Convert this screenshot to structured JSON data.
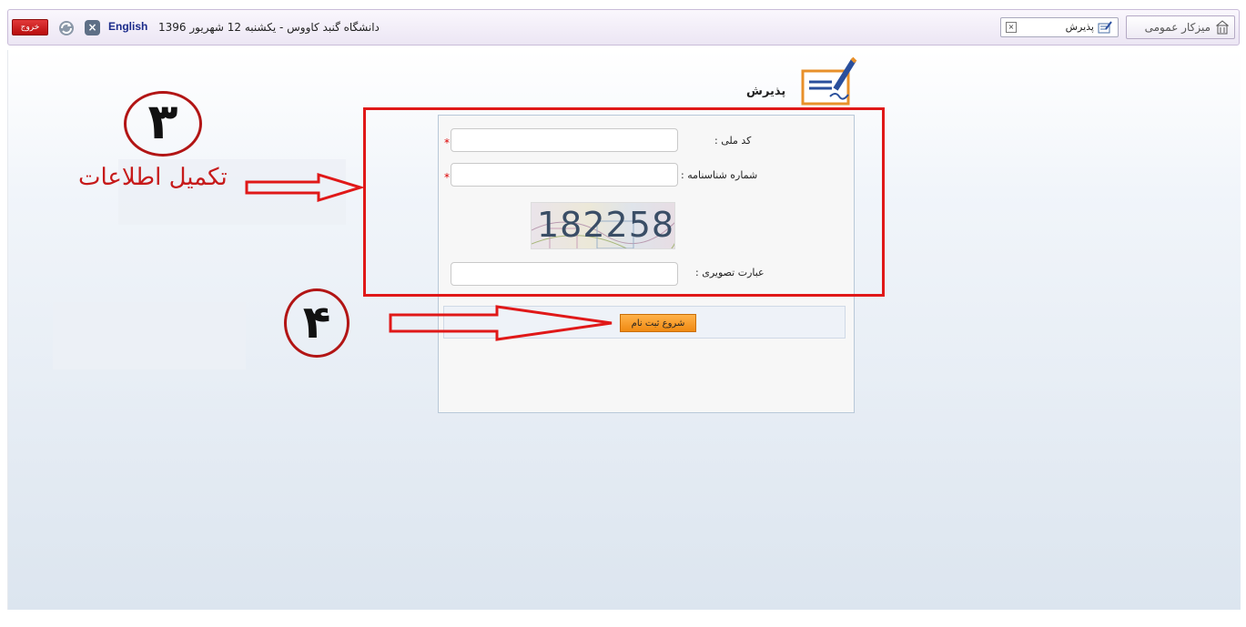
{
  "topbar": {
    "exit_label": "خروج",
    "language_link": "English",
    "status_text": "دانشگاه گنبد کاووس - یکشنبه 12 شهریور 1396",
    "close_all_symbol": "×",
    "tabs": [
      {
        "label": "پذیرش",
        "icon": "form-pen-icon",
        "close_symbol": "×"
      },
      {
        "label": "میزکار عمومی",
        "icon": "building-icon"
      }
    ]
  },
  "page": {
    "title": "پذیرش",
    "icon": "form-pen-icon"
  },
  "form": {
    "fields": [
      {
        "label": "کد ملی :",
        "value": "",
        "required": true,
        "required_mark": "*"
      },
      {
        "label": "شماره شناسنامه :",
        "value": "",
        "required": true,
        "required_mark": "*"
      },
      {
        "label": "عبارت تصویری :",
        "value": "",
        "required": false
      }
    ],
    "captcha_text": "182258",
    "submit_label": "شروع ثبت نام"
  },
  "annotations": {
    "step3_number": "۳",
    "step4_number": "۴",
    "step3_text": "تکمیل اطلاعات",
    "color": "#e01818"
  },
  "colors": {
    "accent_orange": "#f08a12",
    "exit_red": "#c41212",
    "topbar_bg": "#ece6f4"
  }
}
